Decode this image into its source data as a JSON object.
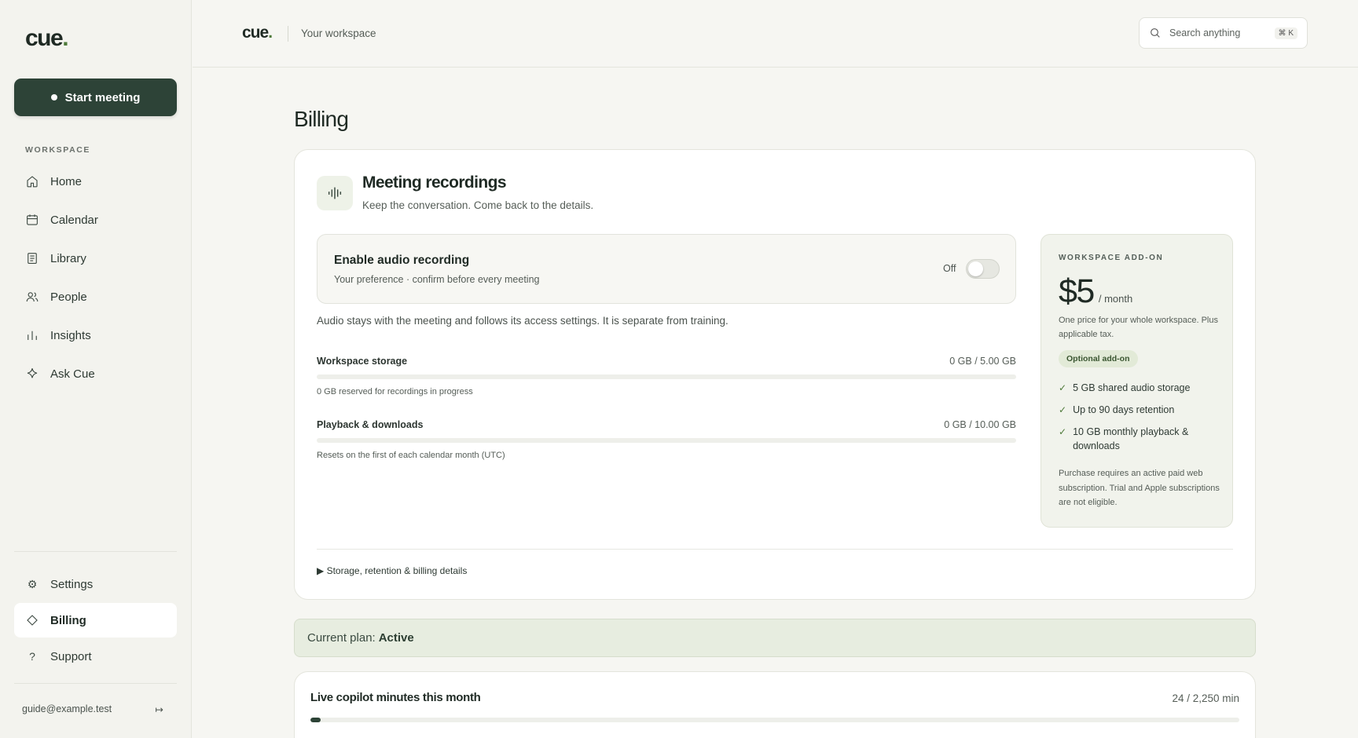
{
  "sidebar": {
    "logo": "cue",
    "logo_dot": ".",
    "start_meeting": "Start meeting",
    "section_label": "WORKSPACE",
    "items": [
      {
        "label": "Home",
        "icon": "home-icon"
      },
      {
        "label": "Calendar",
        "icon": "calendar-icon"
      },
      {
        "label": "Library",
        "icon": "document-icon"
      },
      {
        "label": "People",
        "icon": "people-icon"
      },
      {
        "label": "Insights",
        "icon": "bar-chart-icon"
      },
      {
        "label": "Ask Cue",
        "icon": "sparkle-icon"
      }
    ],
    "bottom_items": [
      {
        "label": "Settings",
        "icon": "gear-icon"
      },
      {
        "label": "Billing",
        "icon": "diamond-icon",
        "active": true
      },
      {
        "label": "Support",
        "icon": "question-icon"
      }
    ],
    "user_email": "guide@example.test",
    "logout_icon": "↦"
  },
  "header": {
    "logo": "cue",
    "logo_dot": ".",
    "workspace": "Your workspace",
    "search_placeholder": "Search anything",
    "search_shortcut": "⌘ K"
  },
  "page": {
    "title": "Billing"
  },
  "recordings": {
    "title": "Meeting recordings",
    "subtitle": "Keep the conversation. Come back to the details.",
    "toggle_title": "Enable audio recording",
    "toggle_subtitle": "Your preference · confirm before every meeting",
    "toggle_state": "Off",
    "toggle_on": false,
    "note": "Audio stays with the meeting and follows its access settings. It is separate from training.",
    "storage": {
      "label": "Workspace storage",
      "value": "0 GB / 5.00 GB",
      "fraction": 0,
      "note": "0 GB reserved for recordings in progress"
    },
    "playback": {
      "label": "Playback & downloads",
      "value": "0 GB / 10.00 GB",
      "fraction": 0,
      "note": "Resets on the first of each calendar month (UTC)"
    },
    "details_label": "▶ Storage, retention & billing details"
  },
  "addon": {
    "label": "WORKSPACE ADD-ON",
    "price": "$5",
    "period": "/ month",
    "description": "One price for your whole workspace. Plus applicable tax.",
    "badge": "Optional add-on",
    "features": [
      "5 GB shared audio storage",
      "Up to 90 days retention",
      "10 GB monthly playback & downloads"
    ],
    "fine_print": "Purchase requires an active paid web subscription. Trial and Apple subscriptions are not eligible."
  },
  "plan": {
    "prefix": "Current plan:",
    "status": "Active"
  },
  "minutes": {
    "title": "Live copilot minutes this month",
    "value": "24 / 2,250 min",
    "used": 24,
    "total": 2250
  },
  "colors": {
    "accent": "#2d4337",
    "brand_dot": "#4e7a3a",
    "background": "#f6f6f2",
    "addon_bg": "#f1f3ec",
    "plan_banner_bg": "#e7ede0"
  }
}
